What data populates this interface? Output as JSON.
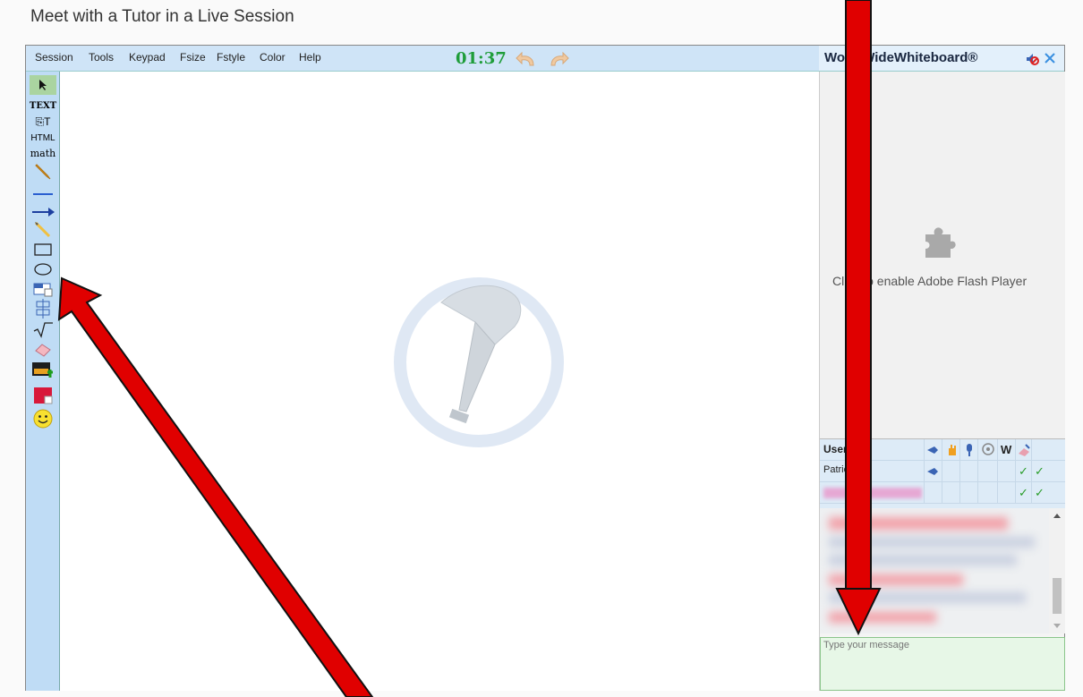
{
  "page": {
    "title": "Meet with a Tutor in a Live Session"
  },
  "menu": {
    "items": [
      "Session",
      "Tools",
      "Keypad",
      "Fsize",
      "Fstyle",
      "Color",
      "Help"
    ],
    "timer": "01:37"
  },
  "brand": {
    "name": "WorldWideWhiteboard®"
  },
  "toolbar": {
    "tools": [
      {
        "name": "select-tool",
        "label": ""
      },
      {
        "name": "text-tool",
        "label": "TEXT"
      },
      {
        "name": "paste-text-tool",
        "label": ""
      },
      {
        "name": "html-tool",
        "label": "HTML"
      },
      {
        "name": "math-tool",
        "label": "math"
      }
    ]
  },
  "flash": {
    "message": "Click to enable Adobe Flash Player"
  },
  "users": {
    "header": "Users (2)",
    "rows": [
      {
        "name": "Patrick S.",
        "w": "✓",
        "e": "✓"
      },
      {
        "name": "",
        "w": "✓",
        "e": "✓"
      }
    ]
  },
  "chat": {
    "placeholder": "Type your message"
  },
  "colors": {
    "menubar": "#cfe4f7",
    "toolbar": "#bfdcf5",
    "timer": "#1f9d3a",
    "arrow": "#e00000"
  }
}
